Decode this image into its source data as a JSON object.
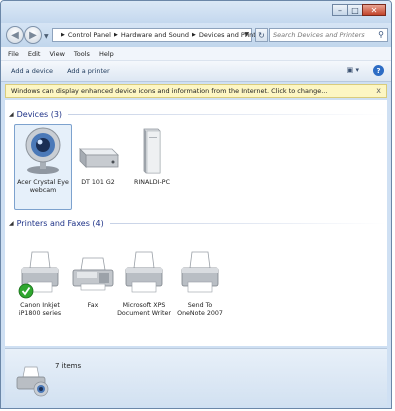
{
  "breadcrumb": [
    "Control Panel",
    "Hardware and Sound",
    "Devices and Printers"
  ],
  "search": {
    "placeholder": "Search Devices and Printers"
  },
  "menu": [
    "File",
    "Edit",
    "View",
    "Tools",
    "Help"
  ],
  "commands": {
    "add_device": "Add a device",
    "add_printer": "Add a printer"
  },
  "infobar": {
    "text": "Windows can display enhanced device icons and information from the Internet. Click to change...",
    "close": "x"
  },
  "groups": {
    "devices": {
      "title": "Devices (3)"
    },
    "printers": {
      "title": "Printers and Faxes (4)"
    }
  },
  "devices": [
    {
      "label_lines": [
        "Acer Crystal Eye",
        "webcam"
      ],
      "icon": "webcam-icon",
      "selected": true
    },
    {
      "label_lines": [
        "DT 101 G2"
      ],
      "icon": "usb-drive-icon",
      "selected": false
    },
    {
      "label_lines": [
        "RINALDI-PC"
      ],
      "icon": "computer-tower-icon",
      "selected": false
    }
  ],
  "printers": [
    {
      "label_lines": [
        "Canon Inkjet",
        "iP1800 series"
      ],
      "icon": "printer-icon",
      "default": true
    },
    {
      "label_lines": [
        "Fax"
      ],
      "icon": "fax-icon",
      "default": false
    },
    {
      "label_lines": [
        "Microsoft XPS",
        "Document Writer"
      ],
      "icon": "printer-icon",
      "default": false
    },
    {
      "label_lines": [
        "Send To",
        "OneNote 2007"
      ],
      "icon": "printer-icon",
      "default": false
    }
  ],
  "status": {
    "text": "7 items",
    "icon": "devices-and-printers-icon"
  },
  "colors": {
    "group_title": "#1e3287",
    "infobar": "#fdf6c3",
    "selection": "#e6f0fa",
    "default_check": "#2fa72f"
  }
}
